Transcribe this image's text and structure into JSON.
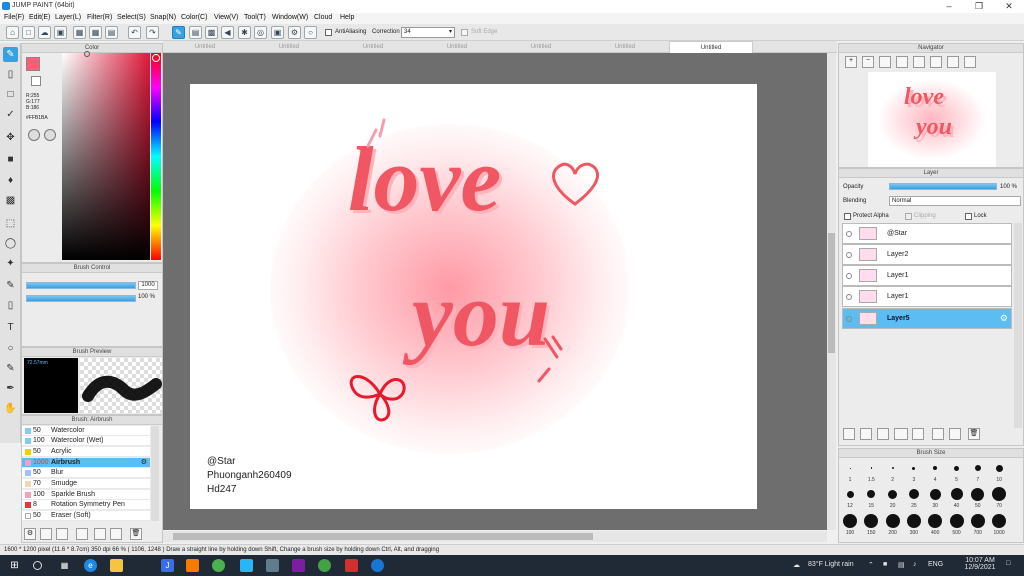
{
  "window": {
    "title": "JUMP PAINT (64bit)"
  },
  "menu": [
    "File(F)",
    "Edit(E)",
    "Layer(L)",
    "Filter(R)",
    "Select(S)",
    "Snap(N)",
    "Color(C)",
    "View(V)",
    "Tool(T)",
    "Window(W)",
    "Cloud",
    "Help"
  ],
  "toolbar": {
    "antialiasing_label": "AntiAliasing",
    "correction_label": "Correction",
    "correction_value": "34",
    "soft_edge_label": "Soft Edge"
  },
  "tabs": [
    "Untitled",
    "Untitled",
    "Untitled",
    "Untitled",
    "Untitled",
    "Untitled",
    "Untitled"
  ],
  "color_panel": {
    "title": "Color",
    "r": "R:255",
    "g": "G:177",
    "b": "B:186",
    "hex": "#FFB1BA",
    "main_color": "#ff5d78",
    "sub_color": "#ffffff"
  },
  "brush_control": {
    "title": "Brush Control",
    "size_value": "1000",
    "opacity_value": "100 %"
  },
  "brush_preview": {
    "title": "Brush Preview",
    "size_text": "72.57mm"
  },
  "brush_list": {
    "title": "Brush: Airbrush",
    "items": [
      {
        "size": "50",
        "name": "Watercolor",
        "color": "#7fd0f0"
      },
      {
        "size": "100",
        "name": "Watercolor (Wet)",
        "color": "#7fd0f0"
      },
      {
        "size": "50",
        "name": "Acrylic",
        "color": "#f2d100"
      },
      {
        "size": "1000",
        "name": "Airbrush",
        "color": "#f5a0c0"
      },
      {
        "size": "50",
        "name": "Blur",
        "color": "#a0c0ff"
      },
      {
        "size": "70",
        "name": "Smudge",
        "color": "#f0d8b0"
      },
      {
        "size": "100",
        "name": "Sparkle Brush",
        "color": "#f5a0c0"
      },
      {
        "size": "8",
        "name": "Rotation Symmetry Pen",
        "color": "#e53935"
      },
      {
        "size": "50",
        "name": "Eraser (Soft)",
        "color": "#ffffff"
      }
    ]
  },
  "canvas": {
    "line1": "love",
    "line2": "you",
    "sig1": "@Star",
    "sig2": "Phuonganh260409",
    "sig3": "Hd247"
  },
  "navigator": {
    "title": "Navigator"
  },
  "layer_panel": {
    "title": "Layer",
    "opacity_label": "Opacity",
    "opacity_value": "100 %",
    "blending_label": "Blending",
    "blending_value": "Normal",
    "protect_alpha": "Protect Alpha",
    "clipping": "Clipping",
    "lock": "Lock",
    "layers": [
      "@Star",
      "Layer2",
      "Layer1",
      "Layer1",
      "Layer5"
    ]
  },
  "brush_size": {
    "title": "Brush Size",
    "row1": [
      "1",
      "1.5",
      "2",
      "3",
      "4",
      "5",
      "7",
      "10"
    ],
    "row2": [
      "12",
      "15",
      "20",
      "25",
      "30",
      "40",
      "50",
      "70"
    ],
    "row3": [
      "100",
      "150",
      "200",
      "300",
      "400",
      "500",
      "700",
      "1000"
    ]
  },
  "status": {
    "text": "1600 * 1200 pixel  (11.6 * 8.7cm)  350 dpi  66 %  ( 1106, 1248 )  Draw a straight line by holding down Shift, Change a brush size by holding down Ctrl, Alt, and dragging"
  },
  "taskbar": {
    "weather": "83°F  Light rain",
    "lang": "ENG",
    "time": "10:07 AM",
    "date": "12/9/2021"
  }
}
